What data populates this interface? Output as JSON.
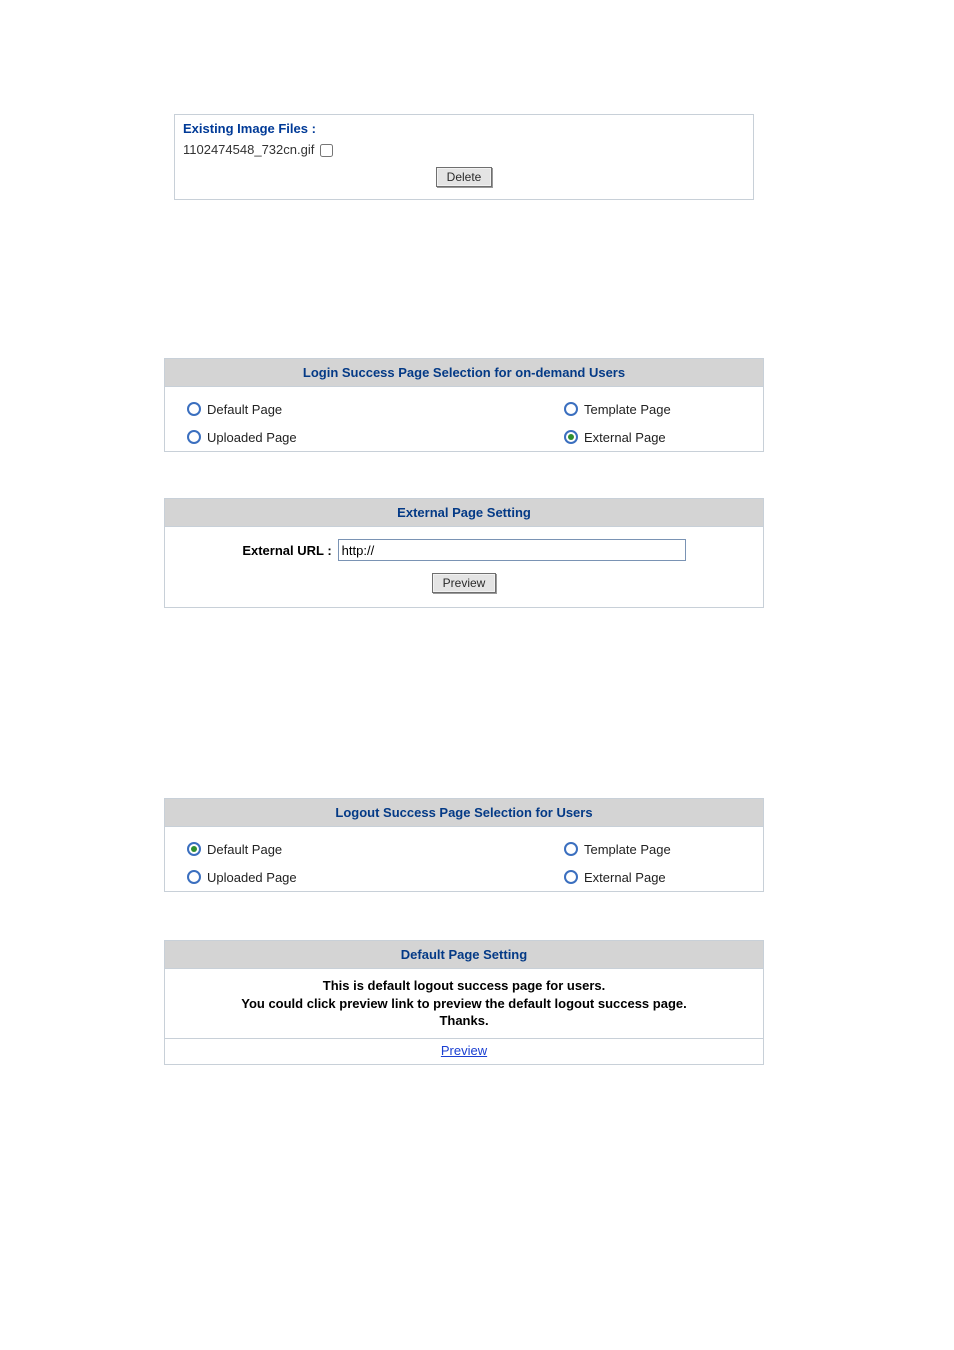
{
  "existing_files": {
    "title": "Existing Image Files :",
    "files": [
      "1102474548_732cn.gif"
    ],
    "delete_label": "Delete"
  },
  "login_selection": {
    "title": "Login Success Page Selection for on-demand Users",
    "options": {
      "default": {
        "label": "Default Page",
        "selected": false
      },
      "template": {
        "label": "Template Page",
        "selected": false
      },
      "uploaded": {
        "label": "Uploaded Page",
        "selected": false
      },
      "external": {
        "label": "External Page",
        "selected": true
      }
    }
  },
  "external_setting": {
    "title": "External Page Setting",
    "url_label": "External URL :",
    "url_value": "http://",
    "preview_label": "Preview"
  },
  "logout_selection": {
    "title": "Logout Success Page Selection for Users",
    "options": {
      "default": {
        "label": "Default Page",
        "selected": true
      },
      "template": {
        "label": "Template Page",
        "selected": false
      },
      "uploaded": {
        "label": "Uploaded Page",
        "selected": false
      },
      "external": {
        "label": "External Page",
        "selected": false
      }
    }
  },
  "default_setting": {
    "title": "Default Page Setting",
    "msg_line1": "This is default logout success page for users.",
    "msg_line2": "You could click preview link to preview the default logout success page.",
    "msg_line3": "Thanks.",
    "preview_label": "Preview"
  }
}
